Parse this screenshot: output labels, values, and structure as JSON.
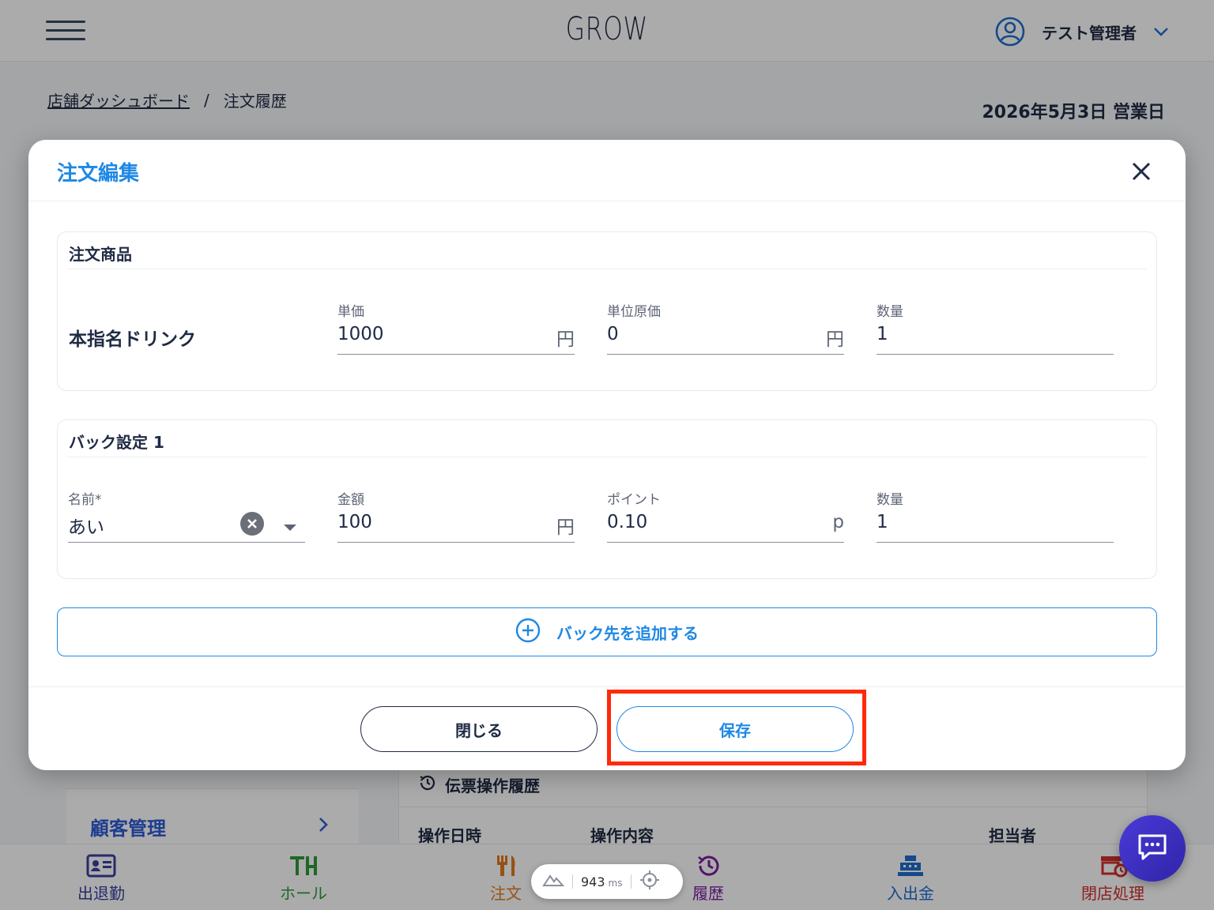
{
  "header": {
    "app_title": "GROW",
    "user_name": "テスト管理者"
  },
  "breadcrumb": {
    "parent": "店舗ダッシュボード",
    "separator": "/",
    "current": "注文履歴"
  },
  "business_date": "2026年5月3日 営業日",
  "sidebar": {
    "customer_label": "顧客管理"
  },
  "history": {
    "title": "伝票操作履歴",
    "columns": [
      "操作日時",
      "操作内容",
      "担当者"
    ]
  },
  "bottom_nav": {
    "items": [
      {
        "label": "出退勤",
        "icon": "id-card-icon",
        "color": "#3a3fa0"
      },
      {
        "label": "ホール",
        "icon": "table-chair-icon",
        "color": "#2e9a3a"
      },
      {
        "label": "注文",
        "icon": "fork-knife-icon",
        "color": "#e07b1f"
      },
      {
        "label": "履歴",
        "icon": "history-icon",
        "color": "#7b1fa2"
      },
      {
        "label": "入出金",
        "icon": "cash-register-icon",
        "color": "#1e6fd0"
      },
      {
        "label": "閉店処理",
        "icon": "store-close-icon",
        "color": "#d32f2f"
      }
    ]
  },
  "perf": {
    "value": "943",
    "unit": "ms"
  },
  "modal": {
    "title": "注文編集",
    "product_section": {
      "title": "注文商品",
      "product_name": "本指名ドリンク",
      "fields": [
        {
          "label": "単価",
          "value": "1000",
          "unit": "円"
        },
        {
          "label": "単位原価",
          "value": "0",
          "unit": "円"
        },
        {
          "label": "数量",
          "value": "1",
          "unit": ""
        }
      ]
    },
    "back_section": {
      "title": "バック設定 1",
      "name_field": {
        "label": "名前*",
        "value": "あい"
      },
      "fields": [
        {
          "label": "金額",
          "value": "100",
          "unit": "円"
        },
        {
          "label": "ポイント",
          "value": "0.10",
          "unit": "p"
        },
        {
          "label": "数量",
          "value": "1",
          "unit": ""
        }
      ]
    },
    "add_back_label": "バック先を追加する",
    "close_label": "閉じる",
    "save_label": "保存"
  },
  "colors": {
    "accent": "#1e88e5",
    "highlight": "#ff2a0a",
    "text": "#1f2a44"
  }
}
